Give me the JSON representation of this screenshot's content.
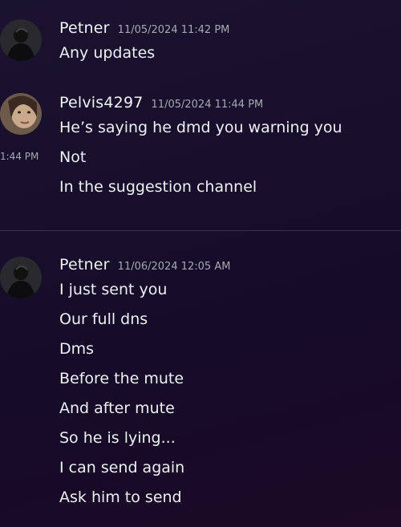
{
  "messages": [
    {
      "username": "Petner",
      "timestamp": "11/05/2024 11:42 PM",
      "lines": [
        "Any updates"
      ]
    },
    {
      "username": "Pelvis4297",
      "timestamp": "11/05/2024 11:44 PM",
      "lines": [
        "He’s saying he dmd you warning you",
        "Not",
        "In the suggestion channel"
      ],
      "hover_time": "1:44 PM"
    },
    {
      "username": "Petner",
      "timestamp": "11/06/2024 12:05 AM",
      "lines": [
        "I just sent you",
        "Our full dns",
        "Dms",
        "Before the mute",
        "And after mute",
        "So he is lying...",
        "I can send again",
        "Ask him to send"
      ]
    }
  ]
}
